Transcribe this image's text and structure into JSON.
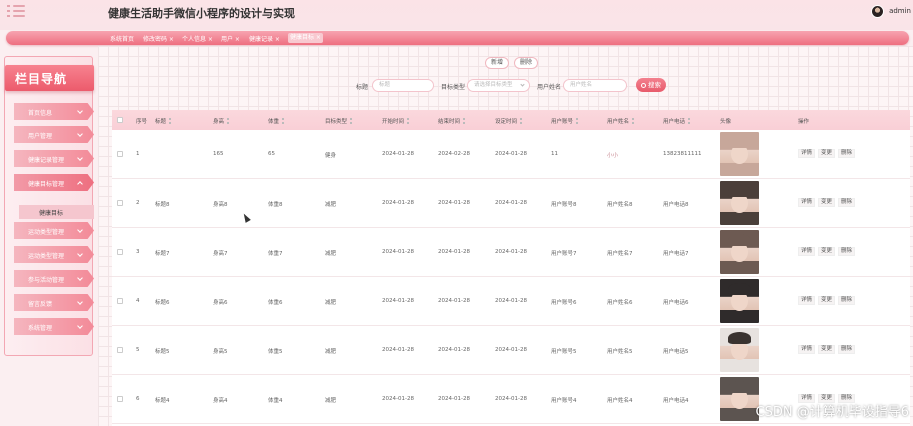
{
  "app_title": "健康生活助手微信小程序的设计与实现",
  "user": {
    "name": "admin"
  },
  "tabs": [
    {
      "label": "系统首页",
      "active": false
    },
    {
      "label": "修改密码",
      "active": false
    },
    {
      "label": "个人信息",
      "active": false
    },
    {
      "label": "用户",
      "active": false
    },
    {
      "label": "健康记录",
      "active": false
    },
    {
      "label": "健康目标",
      "active": true
    }
  ],
  "sidebar": {
    "title": "栏目导航",
    "items": [
      {
        "label": "首页信息"
      },
      {
        "label": "用户管理"
      },
      {
        "label": "健康记录管理"
      },
      {
        "label": "健康目标管理",
        "open": true,
        "sub": [
          {
            "label": "健康目标"
          }
        ]
      },
      {
        "label": "运动类型管理"
      },
      {
        "label": "运动类型管理"
      },
      {
        "label": "参与活动管理"
      },
      {
        "label": "留言反馈"
      },
      {
        "label": "系统管理"
      }
    ]
  },
  "toolbar": {
    "add": "新增",
    "delete": "删除"
  },
  "filters": {
    "title_label": "标题",
    "title_placeholder": "标题",
    "type_label": "目标类型",
    "type_placeholder": "请选择目标类型",
    "name_label": "用户姓名",
    "name_placeholder": "用户姓名",
    "search": "搜索"
  },
  "table": {
    "headers": [
      "序号",
      "标题",
      "身高",
      "体重",
      "目标类型",
      "开始时间",
      "结束时间",
      "设定时间",
      "用户账号",
      "用户姓名",
      "用户电话",
      "头像",
      "操作"
    ],
    "actions": [
      "详情",
      "变更",
      "删除"
    ],
    "rows": [
      {
        "no": "1",
        "title": "",
        "height": "165",
        "weight": "65",
        "type": "健身",
        "start": "2024-01-28",
        "end": "2024-02-28",
        "set": "2024-01-28",
        "account": "11",
        "name": "小小",
        "phone": "13823811111",
        "avatar_color": "#c7a79a"
      },
      {
        "no": "2",
        "title": "标题8",
        "height": "身高8",
        "weight": "体重8",
        "type": "减肥",
        "start": "2024-01-28",
        "end": "2024-01-28",
        "set": "2024-01-28",
        "account": "用户账号8",
        "name": "用户姓名8",
        "phone": "用户电话8",
        "avatar_color": "#4b3f3a"
      },
      {
        "no": "3",
        "title": "标题7",
        "height": "身高7",
        "weight": "体重7",
        "type": "减肥",
        "start": "2024-01-28",
        "end": "2024-01-28",
        "set": "2024-01-28",
        "account": "用户账号7",
        "name": "用户姓名7",
        "phone": "用户电话7",
        "avatar_color": "#6d5a52"
      },
      {
        "no": "4",
        "title": "标题6",
        "height": "身高6",
        "weight": "体重6",
        "type": "减肥",
        "start": "2024-01-28",
        "end": "2024-01-28",
        "set": "2024-01-28",
        "account": "用户账号6",
        "name": "用户姓名6",
        "phone": "用户电话6",
        "avatar_color": "#2f2b2b"
      },
      {
        "no": "5",
        "title": "标题5",
        "height": "身高5",
        "weight": "体重5",
        "type": "减肥",
        "start": "2024-01-28",
        "end": "2024-01-28",
        "set": "2024-01-28",
        "account": "用户账号5",
        "name": "用户姓名5",
        "phone": "用户电话5",
        "avatar_color": "#e7e2df"
      },
      {
        "no": "6",
        "title": "标题4",
        "height": "身高4",
        "weight": "体重4",
        "type": "减肥",
        "start": "2024-01-28",
        "end": "2024-01-28",
        "set": "2024-01-28",
        "account": "用户账号4",
        "name": "用户姓名4",
        "phone": "用户电话4",
        "avatar_color": "#5c5450"
      }
    ]
  },
  "watermark": "CSDN @计算机毕设指导6"
}
